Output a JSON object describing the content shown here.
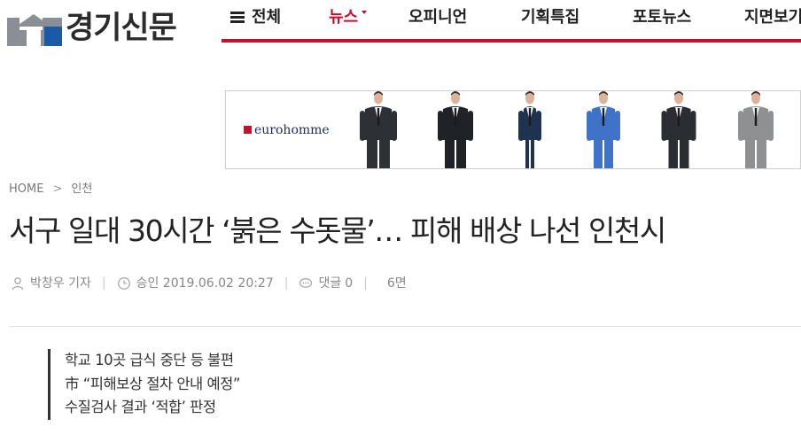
{
  "logo": {
    "text": "경기신문"
  },
  "nav": {
    "items": [
      {
        "label": "전체"
      },
      {
        "label": "뉴스"
      },
      {
        "label": "오피니언"
      },
      {
        "label": "기획특집"
      },
      {
        "label": "포토뉴스"
      },
      {
        "label": "지면보기"
      }
    ],
    "active_index": 1,
    "accent_color": "#c8102e"
  },
  "banner": {
    "brand": "eurohomme",
    "suit_colors": [
      "#2d3035",
      "#1f2226",
      "#1e3350",
      "#3f73c8",
      "#2a2d32",
      "#8e9091"
    ]
  },
  "breadcrumb": {
    "home": "HOME",
    "separator": ">",
    "section": "인천"
  },
  "article": {
    "headline": "서구 일대 30시간 ‘붉은 수돗물’… 피해 배상 나선 인천시",
    "author": "박창우 기자",
    "approved_label": "승인",
    "approved_date": "2019.06.02 20:27",
    "comments_label": "댓글",
    "comments_count": "0",
    "page": "6면",
    "summary": [
      "학교 10곳 급식 중단 등 불편",
      "市 “피해보상 절차 안내 예정”",
      "수질검사 결과 ‘적합’ 판정"
    ]
  }
}
